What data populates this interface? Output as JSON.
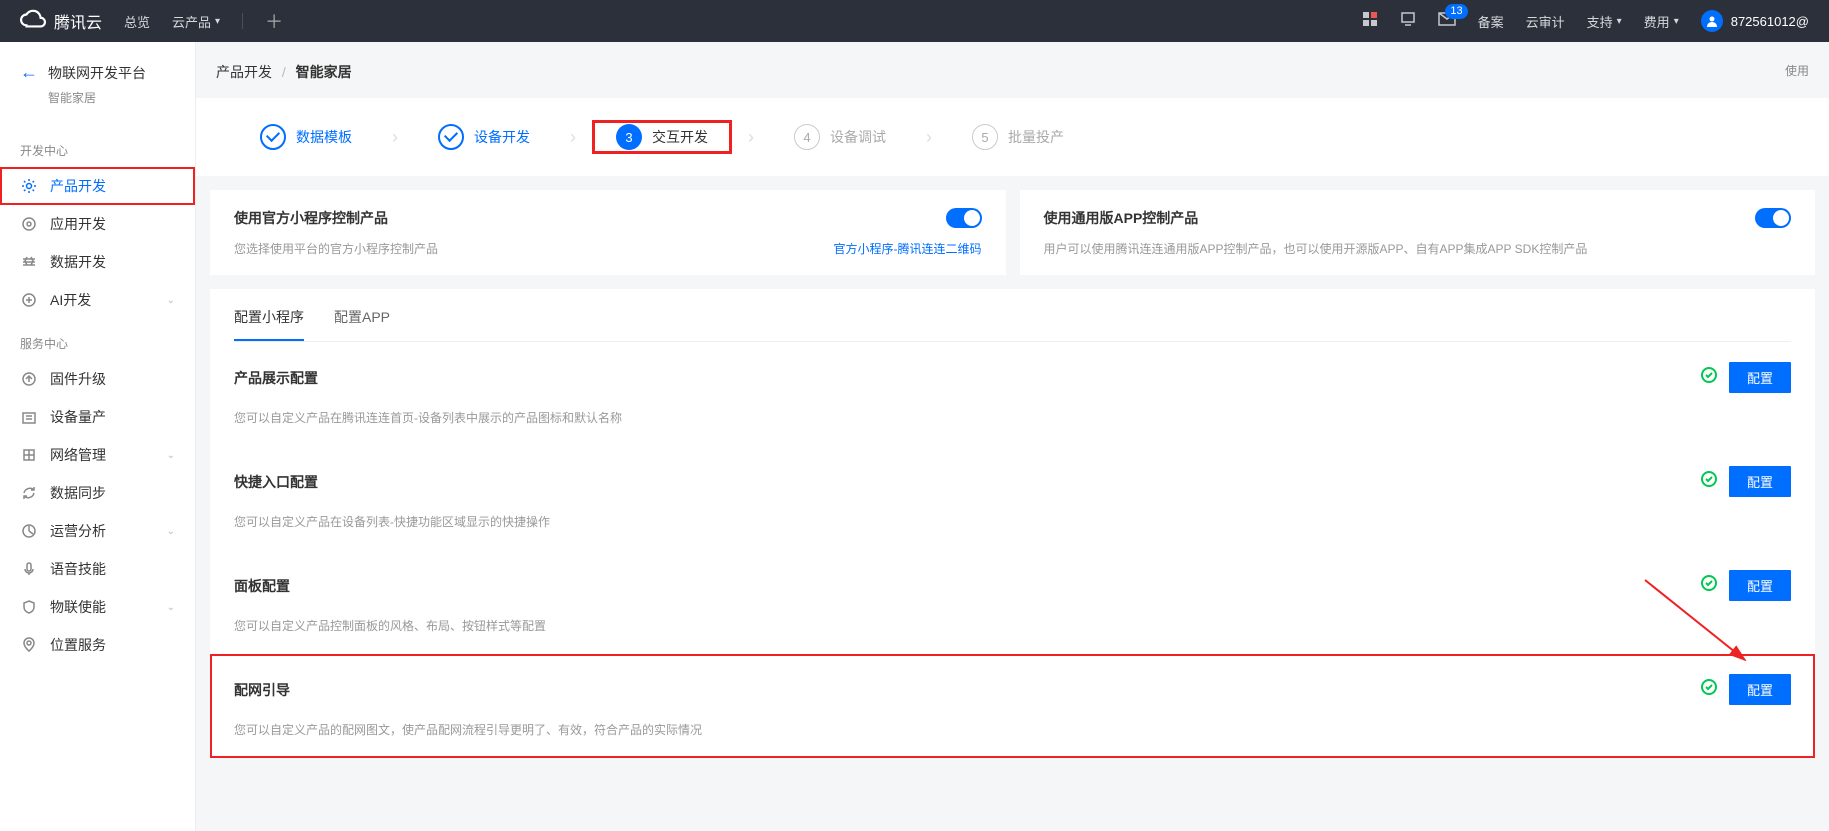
{
  "header": {
    "brand": "腾讯云",
    "overview": "总览",
    "products": "云产品",
    "mail_badge": "13",
    "beian": "备案",
    "audit": "云审计",
    "support": "支持",
    "fee": "费用",
    "user": "872561012@"
  },
  "sidebar": {
    "title": "物联网开发平台",
    "subtitle": "智能家居",
    "sec1": "开发中心",
    "items1": [
      "产品开发",
      "应用开发",
      "数据开发",
      "AI开发"
    ],
    "sec2": "服务中心",
    "items2": [
      "固件升级",
      "设备量产",
      "网络管理",
      "数据同步",
      "运营分析",
      "语音技能",
      "物联使能",
      "位置服务"
    ]
  },
  "breadcrumb": {
    "a": "产品开发",
    "b": "智能家居"
  },
  "steps": {
    "s1": "数据模板",
    "s2": "设备开发",
    "s3": "交互开发",
    "s4": "设备调试",
    "s5": "批量投产",
    "n3": "3",
    "n4": "4",
    "n5": "5"
  },
  "card1": {
    "title": "使用官方小程序控制产品",
    "desc": "您选择使用平台的官方小程序控制产品",
    "link": "官方小程序-腾讯连连二维码"
  },
  "card2": {
    "title": "使用通用版APP控制产品",
    "desc": "用户可以使用腾讯连连通用版APP控制产品，也可以使用开源版APP、自有APP集成APP SDK控制产品"
  },
  "tabs": {
    "t1": "配置小程序",
    "t2": "配置APP"
  },
  "secs": {
    "s1": {
      "title": "产品展示配置",
      "desc": "您可以自定义产品在腾讯连连首页-设备列表中展示的产品图标和默认名称",
      "btn": "配置"
    },
    "s2": {
      "title": "快捷入口配置",
      "desc": "您可以自定义产品在设备列表-快捷功能区域显示的快捷操作",
      "btn": "配置"
    },
    "s3": {
      "title": "面板配置",
      "desc": "您可以自定义产品控制面板的风格、布局、按钮样式等配置",
      "btn": "配置"
    },
    "s4": {
      "title": "配网引导",
      "desc": "您可以自定义产品的配网图文，使产品配网流程引导更明了、有效，符合产品的实际情况",
      "btn": "配置"
    }
  },
  "right_label": "使用"
}
